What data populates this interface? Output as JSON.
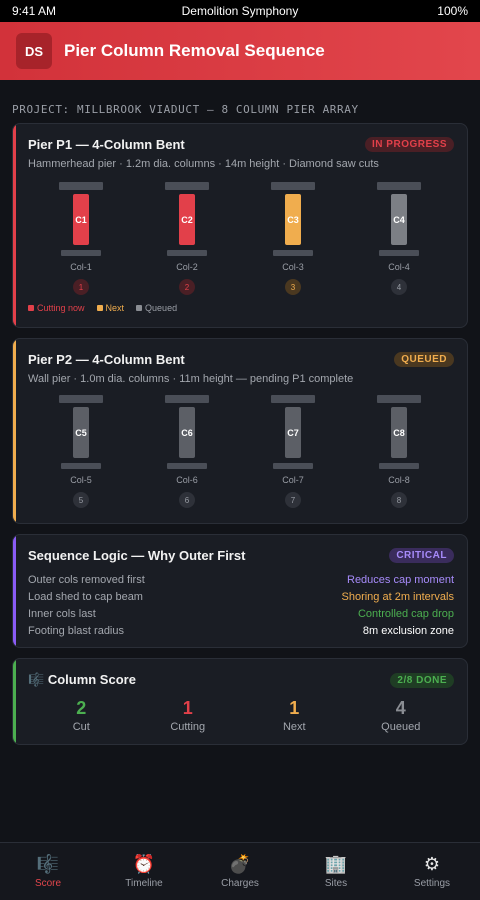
{
  "status_bar": {
    "time": "9:41 AM",
    "carrier": "Demolition Symphony",
    "battery": "100%"
  },
  "header": {
    "logo": "DS",
    "title": "Pier Column Removal Sequence"
  },
  "project_label": "PROJECT: MILLBROOK VIADUCT — 8 COLUMN PIER ARRAY",
  "colors": {
    "cutting": "#e2404a",
    "next": "#f0ad4e",
    "queued": "#8a8d93",
    "ipBadgeBg": "#4a1f25",
    "queuedBadgeBg": "#4a3820",
    "criticalBadgeBg": "#3a2c5c",
    "done": "#4caf50"
  },
  "pier1": {
    "title": "Pier P1 — 4-Column Bent",
    "badge": "IN PROGRESS",
    "subtitle": "Hammerhead pier · 1.2m dia. columns · 14m height · Diamond saw cuts",
    "columns": [
      {
        "code": "C1",
        "name": "Col-1",
        "order": "1",
        "state": "cutting"
      },
      {
        "code": "C2",
        "name": "Col-2",
        "order": "2",
        "state": "cutting"
      },
      {
        "code": "C3",
        "name": "Col-3",
        "order": "3",
        "state": "next"
      },
      {
        "code": "C4",
        "name": "Col-4",
        "order": "4",
        "state": "queued"
      }
    ],
    "legend": {
      "cutting": "Cutting now",
      "next": "Next",
      "queued": "Queued"
    }
  },
  "pier2": {
    "title": "Pier P2 — 4-Column Bent",
    "badge": "QUEUED",
    "subtitle": "Wall pier · 1.0m dia. columns · 11m height — pending P1 complete",
    "columns": [
      {
        "code": "C5",
        "name": "Col-5",
        "order": "5",
        "state": "queued"
      },
      {
        "code": "C6",
        "name": "Col-6",
        "order": "6",
        "state": "queued"
      },
      {
        "code": "C7",
        "name": "Col-7",
        "order": "7",
        "state": "queued"
      },
      {
        "code": "C8",
        "name": "Col-8",
        "order": "8",
        "state": "queued"
      }
    ]
  },
  "logic": {
    "title": "Sequence Logic — Why Outer First",
    "badge": "CRITICAL",
    "rows": [
      {
        "label": "Outer cols removed first",
        "value": "Reduces cap moment",
        "color": "#a78bfa"
      },
      {
        "label": "Load shed to cap beam",
        "value": "Shoring at 2m intervals",
        "color": "#f0ad4e"
      },
      {
        "label": "Inner cols last",
        "value": "Controlled cap drop",
        "color": "#4caf50"
      },
      {
        "label": "Footing blast radius",
        "value": "8m exclusion zone",
        "color": "#ffffff"
      }
    ]
  },
  "score": {
    "icon": "🎼",
    "title": "Column Score",
    "badge": "2/8 DONE",
    "cells": [
      {
        "value": "2",
        "label": "Cut",
        "color": "#4caf50"
      },
      {
        "value": "1",
        "label": "Cutting",
        "color": "#e2404a"
      },
      {
        "value": "1",
        "label": "Next",
        "color": "#f0ad4e"
      },
      {
        "value": "4",
        "label": "Queued",
        "color": "#8a8d93"
      }
    ]
  },
  "tabs": [
    {
      "icon": "🎼",
      "label": "Score",
      "name": "score",
      "active": true
    },
    {
      "icon": "⏰",
      "label": "Timeline",
      "name": "timeline",
      "active": false
    },
    {
      "icon": "💣",
      "label": "Charges",
      "name": "charges",
      "active": false
    },
    {
      "icon": "🏢",
      "label": "Sites",
      "name": "sites",
      "active": false
    },
    {
      "icon": "⚙",
      "label": "Settings",
      "name": "settings",
      "active": false
    }
  ]
}
